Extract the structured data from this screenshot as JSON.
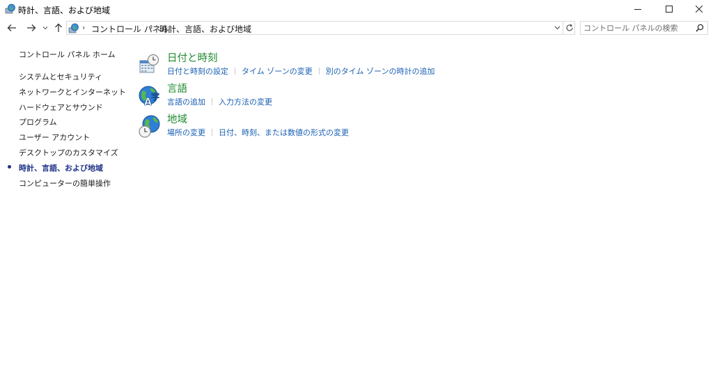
{
  "window": {
    "title": "時計、言語、および地域"
  },
  "navbar": {
    "breadcrumbs": [
      "コントロール パネル",
      "時計、言語、および地域"
    ],
    "search_placeholder": "コントロール パネルの検索"
  },
  "leftnav": {
    "items": [
      {
        "label": "コントロール パネル ホーム"
      },
      {
        "label": "システムとセキュリティ"
      },
      {
        "label": "ネットワークとインターネット"
      },
      {
        "label": "ハードウェアとサウンド"
      },
      {
        "label": "プログラム"
      },
      {
        "label": "ユーザー アカウント"
      },
      {
        "label": "デスクトップのカスタマイズ"
      },
      {
        "label": "時計、言語、および地域",
        "current": true
      },
      {
        "label": "コンピューターの簡単操作"
      }
    ]
  },
  "categories": [
    {
      "title": "日付と時刻",
      "icon": "calendar-clock-icon",
      "links": [
        "日付と時刻の設定",
        "タイム ゾーンの変更",
        "別のタイム ゾーンの時計の追加"
      ]
    },
    {
      "title": "言語",
      "icon": "language-globe-icon",
      "links": [
        "言語の追加",
        "入力方法の変更"
      ]
    },
    {
      "title": "地域",
      "icon": "region-globe-clock-icon",
      "links": [
        "場所の変更",
        "日付、時刻、または数値の形式の変更"
      ]
    }
  ],
  "colors": {
    "category_title": "#1e8a2e",
    "link": "#1a5fb4",
    "current_nav": "#1e3287"
  }
}
